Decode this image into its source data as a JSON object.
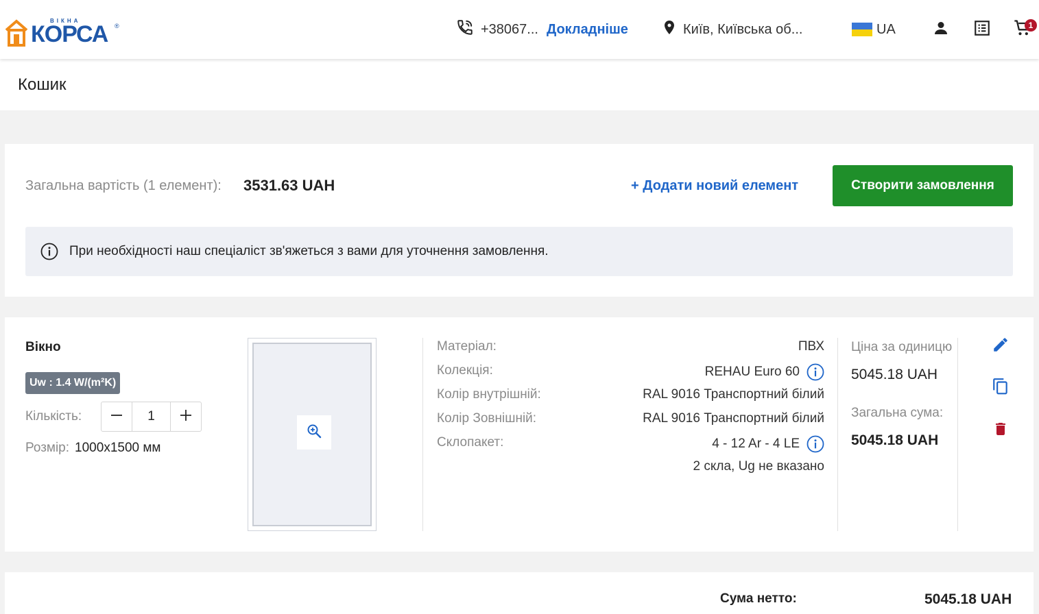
{
  "header": {
    "brand_small": "ВІКНА",
    "brand_main": "КОРСА",
    "brand_reg": "®",
    "phone": "+38067...",
    "phone_more": "Докладніше",
    "location": "Київ, Київська об...",
    "language": "UA",
    "cart_count": "1"
  },
  "page": {
    "title": "Кошик"
  },
  "summary": {
    "total_label": "Загальна вартість (1 елемент):",
    "total_value": "3531.63 UAH",
    "add_item": "+ Додати новий елемент",
    "create_order": "Створити замовлення",
    "notice": "При необхідності наш спеціаліст зв'яжеться з вами для уточнення замовлення."
  },
  "item": {
    "title": "Вікно",
    "uw_badge": "Uw : 1.4 W/(m²K)",
    "qty_label": "Кількість:",
    "qty_value": "1",
    "size_label": "Розмір:",
    "size_value": "1000x1500 мм",
    "props": [
      {
        "key": "Матеріал:",
        "value": "ПВХ"
      },
      {
        "key": "Колекція:",
        "value": "REHAU Euro 60"
      },
      {
        "key": "Колір внутрішній:",
        "value": "RAL 9016 Транспортний білий"
      },
      {
        "key": "Колір Зовнішній:",
        "value": "RAL 9016 Транспортний білий"
      },
      {
        "key": "Склопакет:",
        "value": "4 - 12 Ar - 4 LE"
      },
      {
        "key": "",
        "value": "2 скла, Ug не вказано"
      }
    ],
    "unit_price_label": "Ціна за одиницю",
    "unit_price_value": "5045.18 UAH",
    "total_label": "Загальна сума:",
    "total_value": "5045.18 UAH"
  },
  "totals": {
    "net_label": "Сума нетто:",
    "net_value": "5045.18 UAH"
  },
  "colors": {
    "brand_blue": "#1f57a8",
    "brand_orange": "#f08c1a",
    "link_blue": "#1f66c9",
    "primary_green": "#1f8f2a",
    "delete_red": "#b3162b"
  }
}
